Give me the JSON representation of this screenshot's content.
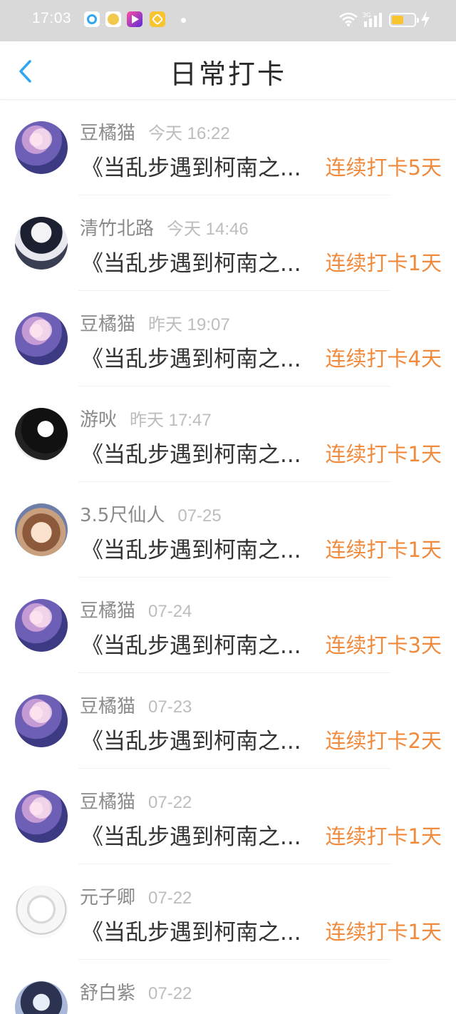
{
  "status_bar": {
    "time": "17:03",
    "network_label": "3G",
    "app_icons": [
      "browser-app-icon",
      "emoji-app-icon",
      "video-app-icon",
      "heart-app-icon"
    ],
    "battery_level": 0.4,
    "accent_battery": "#f7c531"
  },
  "header": {
    "title": "日常打卡",
    "back_icon": "chevron-left-icon",
    "accent": "#2ea6f2"
  },
  "colors": {
    "streak": "#f08a3c",
    "username": "#8a8a8a",
    "time": "#bdbdbd",
    "work_title": "#333333"
  },
  "checkins": [
    {
      "user": "豆橘猫",
      "time": "今天 16:22",
      "work": "《当乱步遇到柯南之...",
      "streak": "连续打卡5天",
      "avatar": "avatar-purple-anime"
    },
    {
      "user": "清竹北路",
      "time": "今天 14:46",
      "work": "《当乱步遇到柯南之...",
      "streak": "连续打卡1天",
      "avatar": "avatar-bw-anime"
    },
    {
      "user": "豆橘猫",
      "time": "昨天 19:07",
      "work": "《当乱步遇到柯南之...",
      "streak": "连续打卡4天",
      "avatar": "avatar-purple-anime"
    },
    {
      "user": "游吙",
      "time": "昨天 17:47",
      "work": "《当乱步遇到柯南之...",
      "streak": "连续打卡1天",
      "avatar": "avatar-dark-silhouette"
    },
    {
      "user": "3.5尺仙人",
      "time": "07-25",
      "work": "《当乱步遇到柯南之...",
      "streak": "连续打卡1天",
      "avatar": "avatar-girl-anime"
    },
    {
      "user": "豆橘猫",
      "time": "07-24",
      "work": "《当乱步遇到柯南之...",
      "streak": "连续打卡3天",
      "avatar": "avatar-purple-anime"
    },
    {
      "user": "豆橘猫",
      "time": "07-23",
      "work": "《当乱步遇到柯南之...",
      "streak": "连续打卡2天",
      "avatar": "avatar-purple-anime"
    },
    {
      "user": "豆橘猫",
      "time": "07-22",
      "work": "《当乱步遇到柯南之...",
      "streak": "连续打卡1天",
      "avatar": "avatar-purple-anime"
    },
    {
      "user": "元子卿",
      "time": "07-22",
      "work": "《当乱步遇到柯南之...",
      "streak": "连续打卡1天",
      "avatar": "avatar-sketch"
    },
    {
      "user": "舒白紫",
      "time": "07-22",
      "work": "",
      "streak": "",
      "avatar": "avatar-bluegirl-anime"
    }
  ]
}
